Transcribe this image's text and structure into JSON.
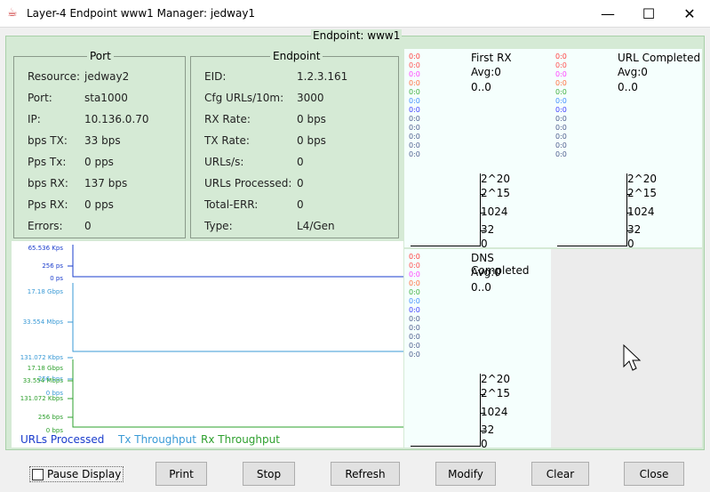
{
  "window": {
    "title": "Layer-4 Endpoint www1  Manager: jedway1",
    "minimize": "—",
    "maximize": "☐",
    "close": "✕"
  },
  "panel_title": "Endpoint: www1",
  "port": {
    "title": "Port",
    "rows": [
      [
        "Resource:",
        "jedway2"
      ],
      [
        "Port:",
        "sta1000"
      ],
      [
        "IP:",
        "10.136.0.70"
      ],
      [
        "bps TX:",
        "33 bps"
      ],
      [
        "Pps Tx:",
        "0 pps"
      ],
      [
        "bps RX:",
        "137 bps"
      ],
      [
        "Pps RX:",
        "0 pps"
      ],
      [
        "Errors:",
        "0"
      ]
    ]
  },
  "endpoint": {
    "title": "Endpoint",
    "rows": [
      [
        "EID:",
        "1.2.3.161"
      ],
      [
        "Cfg URLs/10m:",
        "3000"
      ],
      [
        "RX Rate:",
        "0 bps"
      ],
      [
        "TX Rate:",
        "0 bps"
      ],
      [
        "URLs/s:",
        "0"
      ],
      [
        "URLs Processed:",
        "0"
      ],
      [
        "Total-ERR:",
        "0"
      ],
      [
        "Type:",
        "L4/Gen"
      ]
    ]
  },
  "charts": {
    "urls": {
      "color": "#1a3ccc",
      "ticks": [
        "65.536 Kps",
        "256 ps",
        "0 ps"
      ]
    },
    "tx": {
      "color": "#3a9ad6",
      "ticks": [
        "17.18 Gbps",
        "33.554 Mbps",
        "131.072 Kbps",
        "256 bps",
        "0 bps"
      ]
    },
    "rx": {
      "color": "#2ea02e",
      "ticks": [
        "17.18 Gbps",
        "33.554 Mbps",
        "131.072 Kbps",
        "256 bps",
        "0 bps"
      ]
    },
    "legend": [
      {
        "label": "URLs Processed",
        "color": "#1a3ccc"
      },
      {
        "label": "Tx Throughput",
        "color": "#3a9ad6"
      },
      {
        "label": "Rx Throughput",
        "color": "#2ea02e"
      }
    ]
  },
  "histograms": [
    {
      "title": "First RX",
      "avg": "Avg:0",
      "range": "0..0"
    },
    {
      "title": "URL Completed",
      "avg": "Avg:0",
      "range": "0..0"
    },
    {
      "title": "DNS Completed",
      "avg": "Avg:0",
      "range": "0..0"
    }
  ],
  "hist_counts": {
    "label": "0:0",
    "colors": [
      "#ff4040",
      "#ff5050",
      "#ff40ff",
      "#ff7040",
      "#40b040",
      "#4090ff",
      "#4040ff",
      "#506090",
      "#506090",
      "#506090",
      "#506090",
      "#506090"
    ]
  },
  "hist_axis": [
    "2^20",
    "2^15",
    "1024",
    "32",
    "0"
  ],
  "buttons": {
    "pause": "Pause Display",
    "print": "Print",
    "stop": "Stop",
    "refresh": "Refresh",
    "modify": "Modify",
    "clear": "Clear",
    "close": "Close"
  }
}
